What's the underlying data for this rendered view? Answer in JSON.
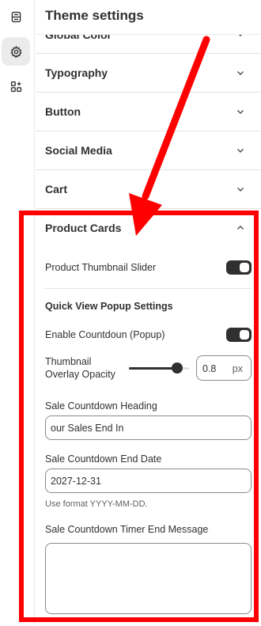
{
  "rail": {
    "items": [
      {
        "icon": "layout-sections-icon",
        "active": false
      },
      {
        "icon": "settings-gear-icon",
        "active": true
      },
      {
        "icon": "apps-add-icon",
        "active": false
      }
    ]
  },
  "panel": {
    "title": "Theme settings",
    "collapsed_sections": [
      {
        "label": "Global Color"
      },
      {
        "label": "Typography"
      },
      {
        "label": "Button"
      },
      {
        "label": "Social Media"
      },
      {
        "label": "Cart"
      }
    ],
    "product_cards": {
      "label": "Product Cards",
      "thumbnail_slider": {
        "label": "Product Thumbnail Slider",
        "enabled": true
      },
      "quick_view_title": "Quick View Popup Settings",
      "enable_countdown": {
        "label": "Enable Countdoun (Popup)",
        "enabled": true
      },
      "overlay_opacity": {
        "label_line1": "Thumbnail",
        "label_line2": "Overlay Opacity",
        "value": "0.8",
        "unit": "px",
        "fraction": 0.8
      },
      "countdown_heading": {
        "label": "Sale Countdown Heading",
        "value": "our Sales End In"
      },
      "countdown_end_date": {
        "label": "Sale Countdown End Date",
        "value": "2027-12-31",
        "help": "Use format YYYY-MM-DD."
      },
      "timer_end_message": {
        "label": "Sale Countdown Timer End Message",
        "value": ""
      }
    }
  },
  "colors": {
    "annotation": "#ff0000",
    "toggle_on": "#303030",
    "text": "#303030",
    "border": "#e3e3e3"
  }
}
